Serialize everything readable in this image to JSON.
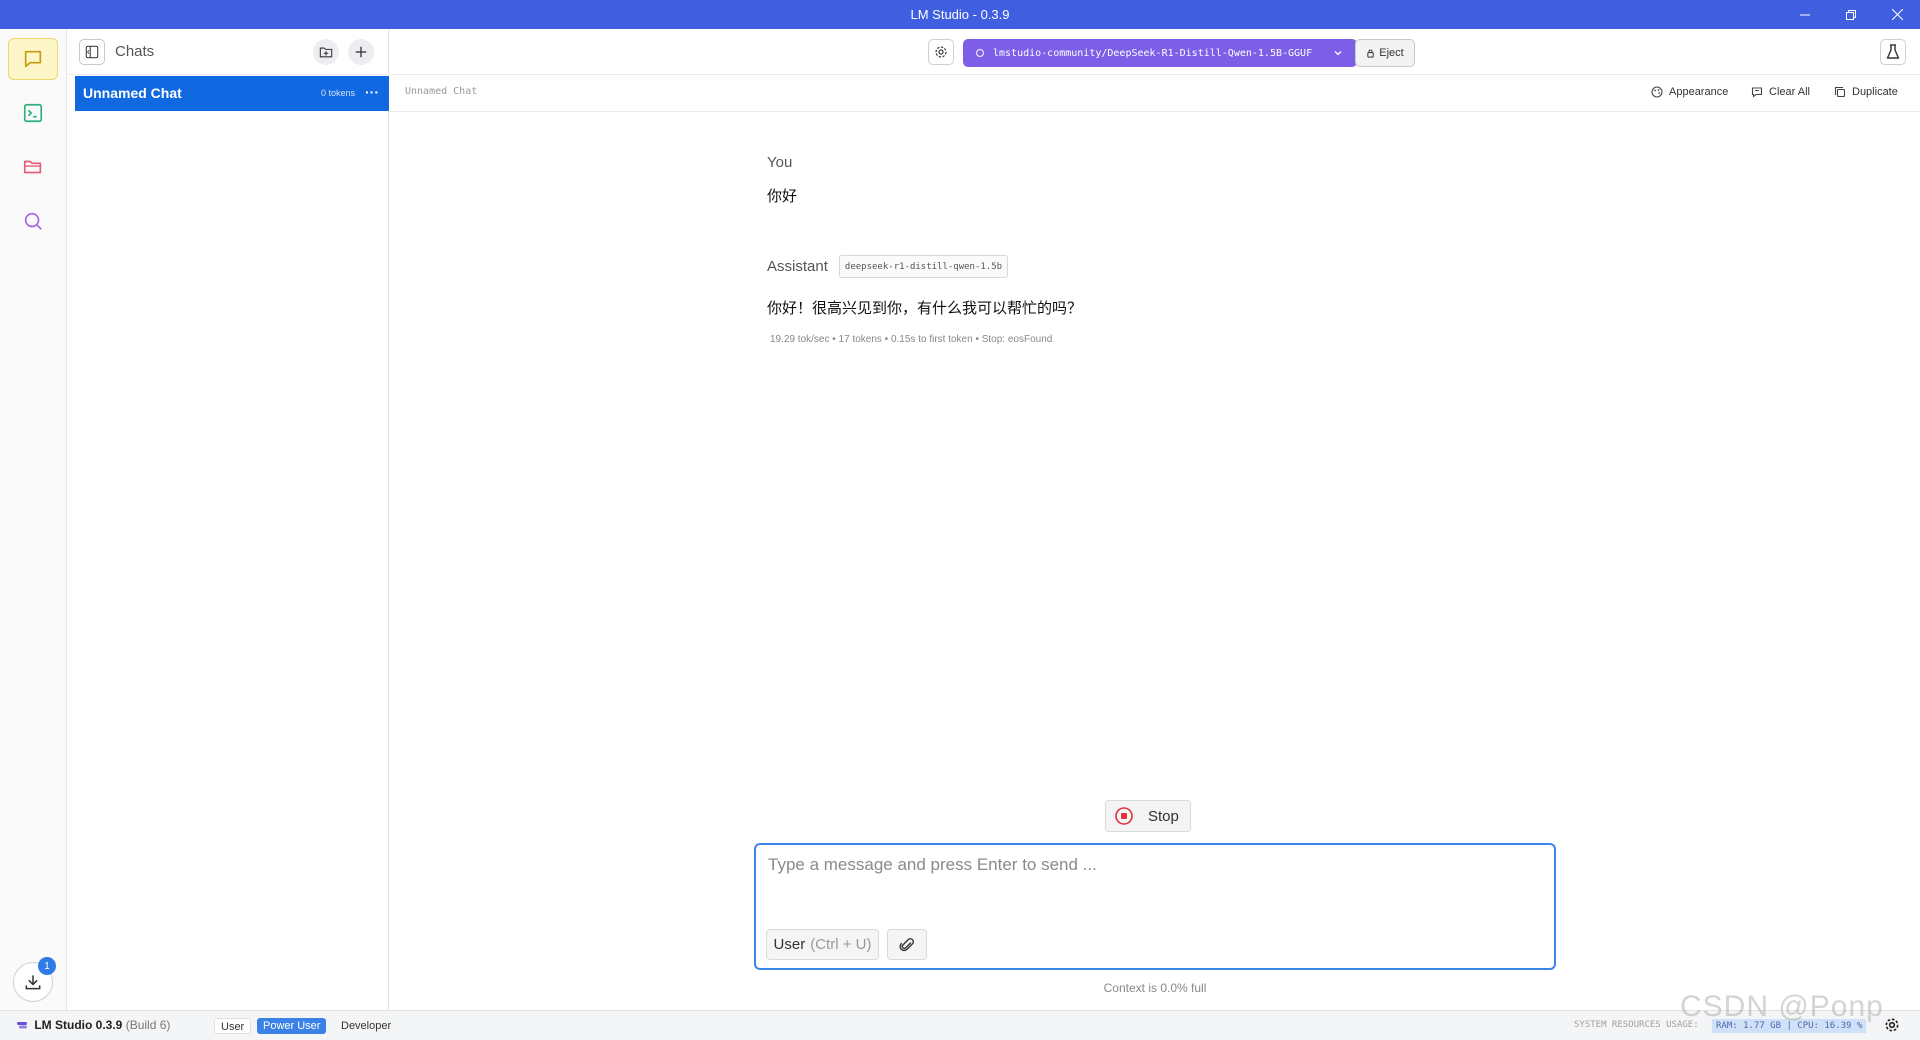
{
  "window": {
    "title": "LM Studio - 0.3.9"
  },
  "sidebar": {
    "title": "Chats",
    "chats": [
      {
        "name": "Unnamed Chat",
        "tokens": "0 tokens"
      }
    ]
  },
  "toolbar": {
    "model": "lmstudio-community/DeepSeek-R1-Distill-Qwen-1.5B-GGUF",
    "eject_label": "Eject"
  },
  "subheader": {
    "chat_title": "Unnamed Chat",
    "appearance_label": "Appearance",
    "clear_all_label": "Clear All",
    "duplicate_label": "Duplicate"
  },
  "messages": [
    {
      "role": "You",
      "text": "你好"
    },
    {
      "role": "Assistant",
      "model": "deepseek-r1-distill-qwen-1.5b",
      "text": "你好！很高兴见到你，有什么我可以帮忙的吗？",
      "stats": "19.29 tok/sec • 17 tokens • 0.15s to first token • Stop: eosFound"
    }
  ],
  "composer": {
    "stop_label": "Stop",
    "placeholder": "Type a message and press Enter to send ...",
    "role_label": "User",
    "role_shortcut": "(Ctrl + U)",
    "context": "Context is 0.0% full"
  },
  "downloads": {
    "count": "1"
  },
  "statusbar": {
    "app_name": "LM Studio 0.3.9",
    "build": "(Build 6)",
    "modes": [
      "User",
      "Power User",
      "Developer"
    ],
    "active_mode": "Power User",
    "resources_label": "SYSTEM RESOURCES USAGE:",
    "resources_value": "RAM: 1.77 GB | CPU: 16.39 %"
  },
  "watermark": "CSDN @Ponp"
}
